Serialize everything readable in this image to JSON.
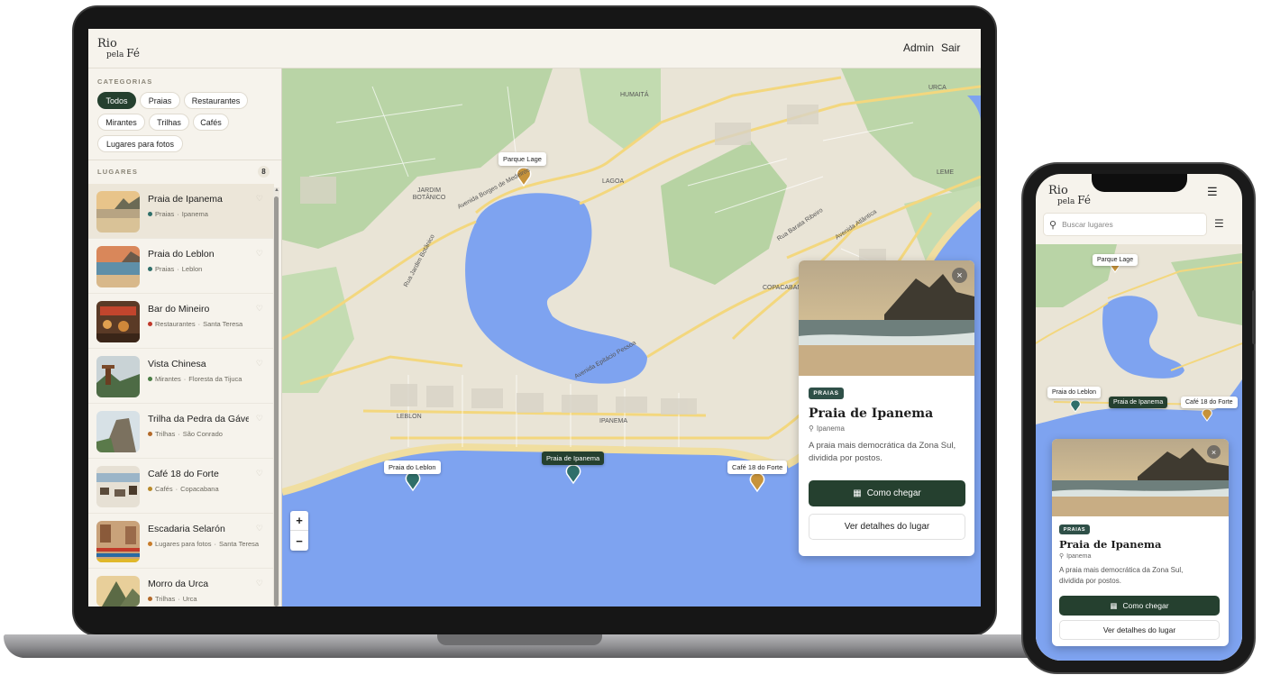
{
  "app": {
    "logo_line1": "Rio",
    "logo_line2a": "pela ",
    "logo_line2b": "Fé",
    "nav": {
      "admin": "Admin",
      "logout": "Sair"
    }
  },
  "sidebar": {
    "categories_label": "CATEGORIAS",
    "categories": [
      "Todos",
      "Praias",
      "Restaurantes",
      "Mirantes",
      "Trilhas",
      "Cafés",
      "Lugares para fotos"
    ],
    "active_category": "Todos",
    "places_label": "LUGARES",
    "places_count": "8",
    "places": [
      {
        "name": "Praia de Ipanema",
        "category": "Praias",
        "area": "Ipanema",
        "dot_color": "#2f6f6a"
      },
      {
        "name": "Praia do Leblon",
        "category": "Praias",
        "area": "Leblon",
        "dot_color": "#2f6f6a"
      },
      {
        "name": "Bar do Mineiro",
        "category": "Restaurantes",
        "area": "Santa Teresa",
        "dot_color": "#c0392b"
      },
      {
        "name": "Vista Chinesa",
        "category": "Mirantes",
        "area": "Floresta da Tijuca",
        "dot_color": "#4a7d45"
      },
      {
        "name": "Trilha da Pedra da Gávea",
        "category": "Trilhas",
        "area": "São Conrado",
        "dot_color": "#b36a2a"
      },
      {
        "name": "Café 18 do Forte",
        "category": "Cafés",
        "area": "Copacabana",
        "dot_color": "#b88a2a"
      },
      {
        "name": "Escadaria Selarón",
        "category": "Lugares para fotos",
        "area": "Santa Teresa",
        "dot_color": "#c87c2a"
      },
      {
        "name": "Morro da Urca",
        "category": "Trilhas",
        "area": "Urca",
        "dot_color": "#b36a2a"
      }
    ]
  },
  "map": {
    "labels": {
      "humaita": "HUMAITÁ",
      "urca": "URCA",
      "jardim_botanico": "JARDIM BOTÂNICO",
      "lagoa": "LAGOA",
      "leme": "LEME",
      "copacabana": "COPACABANA",
      "leblon": "LEBLON",
      "ipanema": "IPANEMA",
      "av_borges": "Avenida Borges de Medeiros",
      "av_epitacio": "Avenida Epitácio Pessoa",
      "rua_jardim": "Rua Jardim Botânico",
      "av_atlantica": "Avenida Atlântica",
      "rua_barata": "Rua Barata Ribeiro"
    },
    "pins": {
      "parque_lage": "Parque Lage",
      "praia_leblon": "Praia do Leblon",
      "praia_ipanema": "Praia de Ipanema",
      "cafe_forte": "Café 18 do Forte"
    },
    "zoom_in": "+",
    "zoom_out": "−"
  },
  "detail": {
    "tag": "PRAIAS",
    "title": "Praia de Ipanema",
    "location": "Ipanema",
    "description_line1": "A praia mais democrática da Zona Sul,",
    "description_line2": "dividida por postos.",
    "primary_button": "Como chegar",
    "secondary_button": "Ver detalhes do lugar",
    "close": "×"
  },
  "mobile": {
    "search_placeholder": "Buscar lugares",
    "menu_icon": "☰",
    "pins": {
      "parque_lage": "Parque Lage",
      "praia_leblon": "Praia do Leblon",
      "praia_ipanema": "Praia de Ipanema",
      "cafe_forte": "Café 18 do Forte"
    }
  },
  "colors": {
    "accent_green": "#25402f",
    "water": "#7ea3f0",
    "land": "#e9e4d6",
    "park": "#b9d4a6",
    "road": "#f3d77e"
  }
}
